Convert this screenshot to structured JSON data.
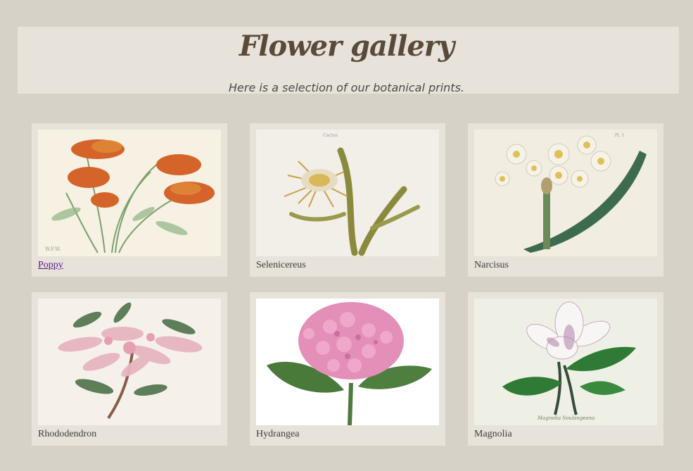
{
  "header": {
    "title": "Flower gallery",
    "subtitle": "Here is a selection of our botanical prints."
  },
  "gallery": {
    "items": [
      {
        "caption": "Poppy",
        "is_link": true
      },
      {
        "caption": "Selenicereus",
        "is_link": false
      },
      {
        "caption": "Narcisus",
        "is_link": false
      },
      {
        "caption": "Rhododendron",
        "is_link": false
      },
      {
        "caption": "Hydrangea",
        "is_link": false
      },
      {
        "caption": "Magnolia",
        "is_link": false
      }
    ]
  },
  "colors": {
    "page_background": "#d6d2c8",
    "panel_background": "#e7e3da",
    "title_color": "#5a4a3c",
    "link_color": "#551a8b"
  }
}
